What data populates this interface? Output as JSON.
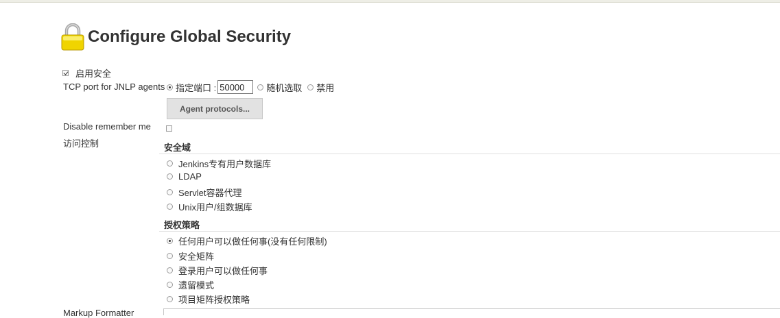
{
  "page": {
    "title": "Configure Global Security"
  },
  "enable_security": {
    "label": "启用安全",
    "checked": true
  },
  "tcp_port": {
    "label": "TCP port for JNLP agents",
    "options": [
      {
        "label": "指定端口 :",
        "selected": true
      },
      {
        "label": "随机选取",
        "selected": false
      },
      {
        "label": "禁用",
        "selected": false
      }
    ],
    "port_value": "50000"
  },
  "agent_protocols_button": "Agent protocols...",
  "disable_remember_me": {
    "label": "Disable remember me",
    "checked": false
  },
  "access_control": {
    "label": "访问控制",
    "security_realm": {
      "heading": "安全域",
      "options": [
        {
          "label": "Jenkins专有用户数据库",
          "selected": false
        },
        {
          "label": "LDAP",
          "selected": false
        },
        {
          "label": "Servlet容器代理",
          "selected": false
        },
        {
          "label": "Unix用户/组数据库",
          "selected": false
        }
      ]
    },
    "authorization": {
      "heading": "授权策略",
      "options": [
        {
          "label": "任何用户可以做任何事(没有任何限制)",
          "selected": true
        },
        {
          "label": "安全矩阵",
          "selected": false
        },
        {
          "label": "登录用户可以做任何事",
          "selected": false
        },
        {
          "label": "遗留模式",
          "selected": false
        },
        {
          "label": "项目矩阵授权策略",
          "selected": false
        }
      ]
    }
  },
  "markup_formatter": {
    "label": "Markup Formatter"
  },
  "icons": {
    "title_icon": "lock-icon"
  },
  "colors": {
    "lock_body": "#f2d90a",
    "lock_shackle": "#b9b9b9",
    "button_bg": "#e2e2e2"
  }
}
